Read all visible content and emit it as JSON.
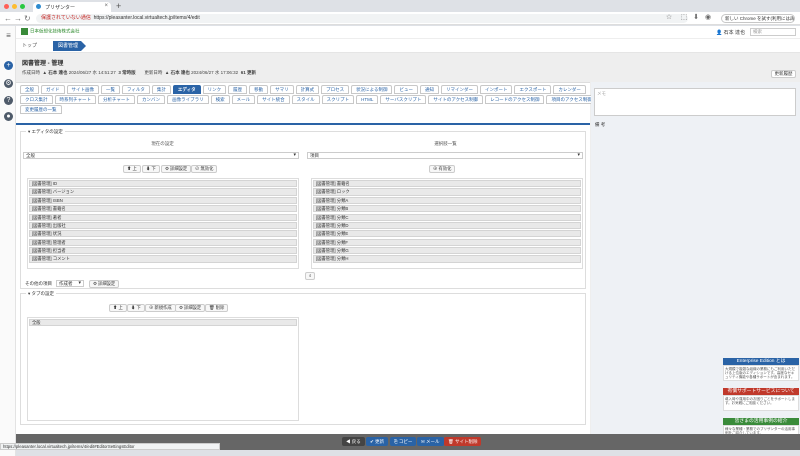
{
  "browser": {
    "tab_title": "プリザンター",
    "url_warning": "保護されていない通信",
    "url": "https://pleasanter.local.virtualtech.jp/items/4/edit",
    "new_chrome": "新しい Chrome を試す(利用には再起動が必要です)"
  },
  "app": {
    "logo": "日本仮想化技術株式会社",
    "user": "石本 達也",
    "search_placeholder": "検索"
  },
  "breadcrumb": {
    "top": "トップ",
    "current": "図書管理"
  },
  "page": {
    "title": "図書管理 - 管理",
    "created_label": "作成日時",
    "created_user": "石本 達也",
    "created_at": "2024/06/27 水 14:51:27",
    "version": "3 常時版",
    "updated_label": "更新日時",
    "updated_user": "石本 達也",
    "updated_at": "2024/06/27 水 17:06:32",
    "ver_count": "61 更新",
    "history_button": "更新履歴"
  },
  "tabs": [
    [
      "全般",
      "ガイド",
      "サイト画像",
      "一覧",
      "フィルタ",
      "集計",
      "エディタ",
      "リンク",
      "履歴",
      "移動",
      "サマリ",
      "計算式",
      "プロセス",
      "状況による制御",
      "ビュー",
      "通知",
      "リマインダー",
      "インポート",
      "エクスポート",
      "カレンダー"
    ],
    [
      "クロス集計",
      "時系列チャート",
      "分析チャート",
      "カンバン",
      "画像ライブラリ",
      "検索",
      "メール",
      "サイト統合",
      "スタイル",
      "スクリプト",
      "HTML",
      "サーバスクリプト",
      "サイトのアクセス制御",
      "レコードのアクセス制御",
      "項目のアクセス制御"
    ],
    [
      "変更履歴の一覧"
    ]
  ],
  "active_tab": "エディタ",
  "editor": {
    "legend": "エディタの設定",
    "current_header": "現在の設定",
    "select_header": "選択肢一覧",
    "current_select": "全般",
    "select_select": "項目",
    "buttons": {
      "up": "上",
      "down": "下",
      "detail": "詳細設定",
      "disable": "無効化",
      "enable": "有効化"
    },
    "current_items": [
      "[図書管理] ID",
      "[図書管理] バージョン",
      "[図書管理] ISBN",
      "[図書管理] 書籍名",
      "[図書管理] 著者",
      "[図書管理] 出版社",
      "[図書管理] 状況",
      "[図書管理] 管理者",
      "[図書管理] 担当者",
      "[図書管理] コメント"
    ],
    "select_items": [
      "[図書管理] 書籍名",
      "[図書管理] ロック",
      "[図書管理] 分類A",
      "[図書管理] 分類B",
      "[図書管理] 分類C",
      "[図書管理] 分類D",
      "[図書管理] 分類E",
      "[図書管理] 分類F",
      "[図書管理] 分類G",
      "[図書管理] 分類H"
    ],
    "other_label": "その他の項目",
    "other_select": "作成者",
    "other_detail": "詳細設定"
  },
  "tabset": {
    "legend": "タブの設定",
    "buttons": {
      "up": "上",
      "down": "下",
      "new": "新規作成",
      "detail": "詳細設定",
      "delete": "削除"
    },
    "items": [
      "全般"
    ]
  },
  "side": {
    "memo_placeholder": "メモ",
    "memo_label": "備 考",
    "ads": [
      {
        "title": "Enterprise Edition とは",
        "body": "大規模で複雑な組織の業務にもご利用いただける上位版のエディションです。高度なセキュリティ機能や各種サポートが含まれます。",
        "color": "#2a63a6"
      },
      {
        "title": "有償サポートサービスについて",
        "body": "導入時や運用中のお困りごとをサポートします。お気軽にご相談ください。",
        "color": "#c0392b"
      },
      {
        "title": "皆さまの活用事例の紹介",
        "body": "様々な業種・業務でのプリザンターの活用事例をご紹介しています。",
        "color": "#3a8b3a"
      }
    ]
  },
  "footer": {
    "back": "戻る",
    "update": "更新",
    "copy": "コピー",
    "mail": "メール",
    "delete": "サイト削除"
  },
  "status_url": "https://pleasanter.local.virtualtech.jp/items/4/edit#EditorSettingsEditor"
}
